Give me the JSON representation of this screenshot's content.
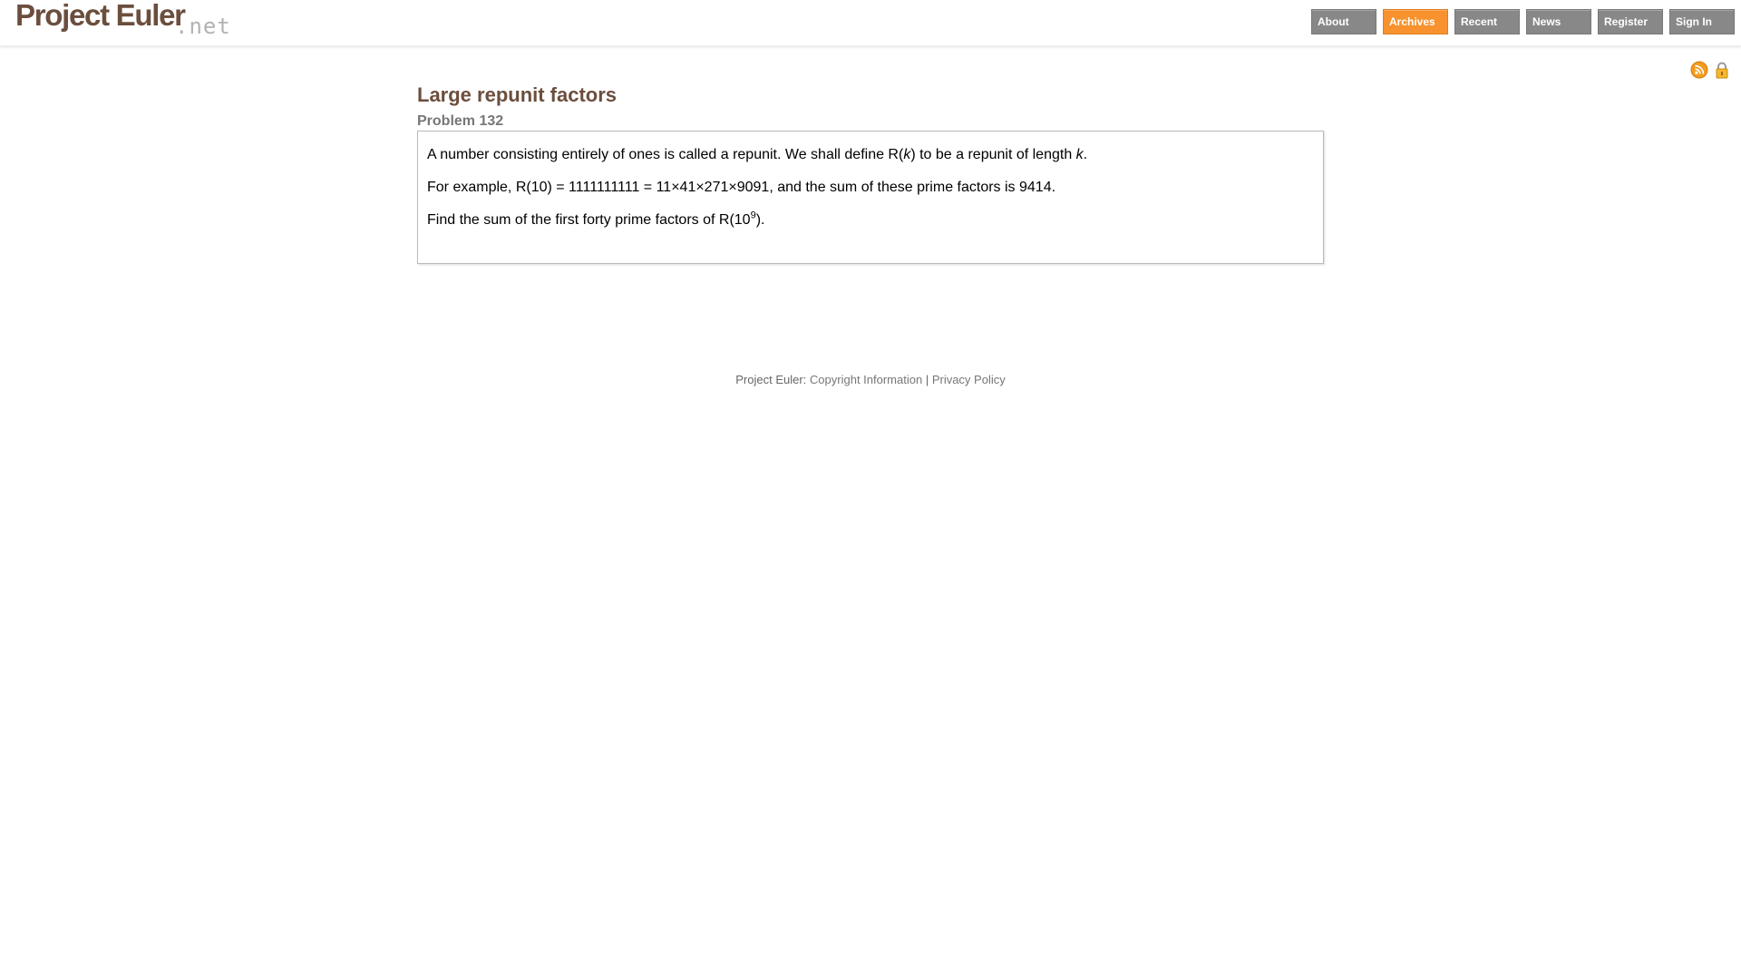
{
  "site": {
    "logo_main": "Project Euler",
    "logo_suffix": ".net"
  },
  "nav": {
    "items": [
      {
        "label": "About"
      },
      {
        "label": "Archives"
      },
      {
        "label": "Recent"
      },
      {
        "label": "News"
      },
      {
        "label": "Register"
      },
      {
        "label": "Sign In"
      }
    ],
    "active_label": "Archives",
    "active_color": "#f7922e",
    "inactive_color": "#888888"
  },
  "tools": {
    "rss_icon": "rss-feed-icon",
    "lock_icon": "lock-icon"
  },
  "problem": {
    "title": "Large repunit factors",
    "info": "Problem 132",
    "p1_pre": "A number consisting entirely of ones is called a repunit. We shall define R(",
    "p1_var": "k",
    "p1_mid": ") to be a repunit of length ",
    "p1_var2": "k",
    "p1_end": ".",
    "p2": "For example, R(10) = 1111111111 = 11×41×271×9091, and the sum of these prime factors is 9414.",
    "p3_pre": "Find the sum of the first forty prime factors of R(10",
    "p3_sup": "9",
    "p3_end": ")."
  },
  "footer": {
    "prefix": "Project Euler: ",
    "copyright": "Copyright Information",
    "separator": " | ",
    "privacy": "Privacy Policy"
  },
  "colors": {
    "brand_brown": "#6b4e3d",
    "accent_orange": "#f7922e"
  }
}
